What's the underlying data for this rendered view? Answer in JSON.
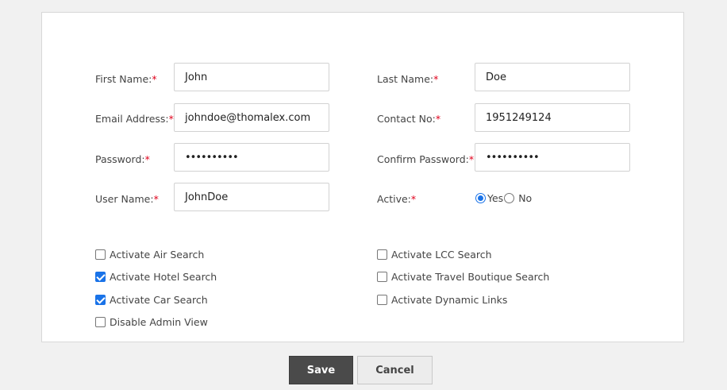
{
  "form": {
    "first_name": {
      "label": "First Name:",
      "value": "John"
    },
    "last_name": {
      "label": "Last Name:",
      "value": "Doe"
    },
    "email": {
      "label": "Email Address:",
      "value": "johndoe@thomalex.com"
    },
    "contact": {
      "label": "Contact No:",
      "value": "1951249124"
    },
    "password": {
      "label": "Password:",
      "value": "••••••••••"
    },
    "confirm_password": {
      "label": "Confirm Password:",
      "value": "••••••••••"
    },
    "user_name": {
      "label": "User Name:",
      "value": "JohnDoe"
    },
    "active": {
      "label": "Active:",
      "yes_label": "Yes",
      "no_label": "No",
      "selected": "Yes"
    },
    "required_mark": "*"
  },
  "options": {
    "activate_air": {
      "label": "Activate Air Search",
      "checked": false
    },
    "activate_hotel": {
      "label": "Activate Hotel Search",
      "checked": true
    },
    "activate_car": {
      "label": "Activate Car Search",
      "checked": true
    },
    "disable_admin": {
      "label": "Disable Admin View",
      "checked": false
    },
    "activate_lcc": {
      "label": "Activate LCC Search",
      "checked": false
    },
    "activate_travel_boutique": {
      "label": "Activate Travel Boutique Search",
      "checked": false
    },
    "activate_dynamic_links": {
      "label": "Activate Dynamic Links",
      "checked": false
    }
  },
  "actions": {
    "save_label": "Save",
    "cancel_label": "Cancel"
  },
  "colors": {
    "accent": "#1a73e8",
    "required": "#e0001b",
    "save_bg": "#4a4a4a"
  }
}
